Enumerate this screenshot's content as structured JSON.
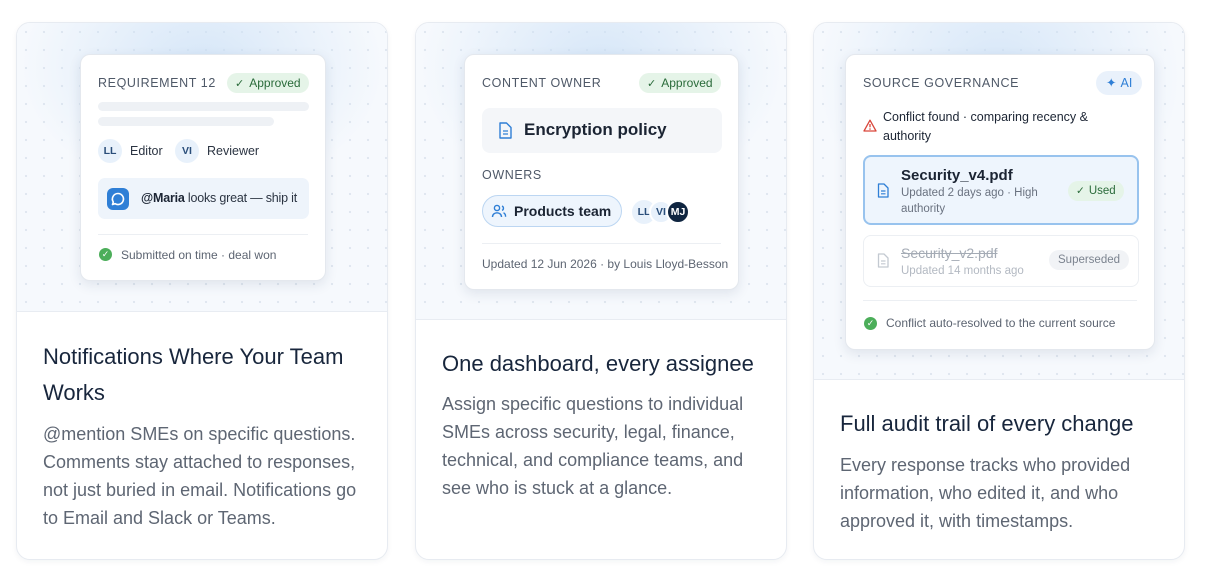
{
  "cards": [
    {
      "panel": {
        "eyebrow": "REQUIREMENT 12",
        "status": "Approved",
        "roles": [
          {
            "initials": "LL",
            "label": "Editor"
          },
          {
            "initials": "VI",
            "label": "Reviewer"
          }
        ],
        "comment_mention": "@Maria",
        "comment_text": " looks great — ship it",
        "footer": "Submitted on time · deal won"
      },
      "title": "Notifications Where Your Team Works",
      "description": "@mention SMEs on specific questions. Comments stay attached to responses, not just buried in email. Notifications go to Email and Slack or Teams."
    },
    {
      "panel": {
        "eyebrow": "CONTENT OWNER",
        "status": "Approved",
        "document": "Encryption policy",
        "owners_label": "OWNERS",
        "team": "Products team",
        "avatars": [
          "LL",
          "VI",
          "MJ"
        ],
        "footer": "Updated 12 Jun 2026 · by Louis Lloyd-Besson"
      },
      "title": "One dashboard, every assignee",
      "description": "Assign specific questions to individual SMEs across security, legal, finance, technical, and compliance teams, and see who is stuck at a glance."
    },
    {
      "panel": {
        "eyebrow": "SOURCE GOVERNANCE",
        "ai_badge": "AI",
        "conflict": "Conflict found · comparing recency & authority",
        "sources": [
          {
            "name": "Security_v4.pdf",
            "meta": "Updated 2 days ago · High authority",
            "status": "Used"
          },
          {
            "name": "Security_v2.pdf",
            "meta": "Updated 14 months ago",
            "status": "Superseded"
          }
        ],
        "footer": "Conflict auto-resolved to the current source"
      },
      "title": "Full audit trail of every change",
      "description": "Every response tracks who provided information, who edited it, and who approved it, with timestamps."
    }
  ],
  "colors": {
    "accent": "#2f7fd6",
    "approved_bg": "#e5f4e8",
    "approved_text": "#2a6b3a",
    "success": "#4cae5a",
    "warning": "#d9463b",
    "dark_avatar": "#0f2540"
  },
  "icons": [
    "check-icon",
    "comment-bubble-icon",
    "document-icon",
    "users-icon",
    "sparkle-icon",
    "warning-triangle-icon",
    "check-circle-icon"
  ]
}
